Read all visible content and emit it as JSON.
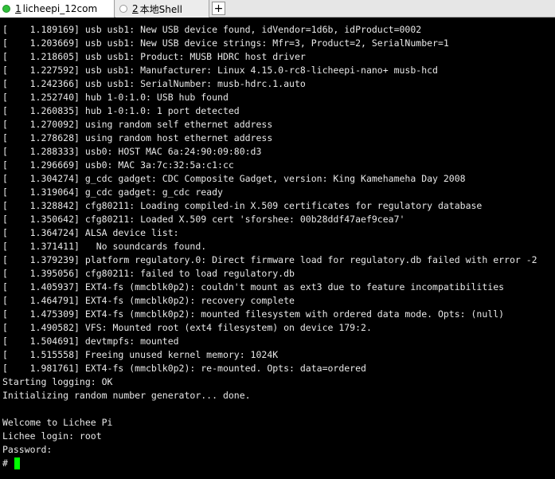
{
  "tabs": [
    {
      "number": "1",
      "label": "licheepi_12com",
      "active": true
    },
    {
      "number": "2",
      "label": "本地Shell",
      "active": false
    }
  ],
  "new_tab_label": "+",
  "terminal": {
    "lines": [
      "[    1.189169] usb usb1: New USB device found, idVendor=1d6b, idProduct=0002",
      "[    1.203669] usb usb1: New USB device strings: Mfr=3, Product=2, SerialNumber=1",
      "[    1.218605] usb usb1: Product: MUSB HDRC host driver",
      "[    1.227592] usb usb1: Manufacturer: Linux 4.15.0-rc8-licheepi-nano+ musb-hcd",
      "[    1.242366] usb usb1: SerialNumber: musb-hdrc.1.auto",
      "[    1.252740] hub 1-0:1.0: USB hub found",
      "[    1.260835] hub 1-0:1.0: 1 port detected",
      "[    1.270092] using random self ethernet address",
      "[    1.278628] using random host ethernet address",
      "[    1.288333] usb0: HOST MAC 6a:24:90:09:80:d3",
      "[    1.296669] usb0: MAC 3a:7c:32:5a:c1:cc",
      "[    1.304274] g_cdc gadget: CDC Composite Gadget, version: King Kamehameha Day 2008",
      "[    1.319064] g_cdc gadget: g_cdc ready",
      "[    1.328842] cfg80211: Loading compiled-in X.509 certificates for regulatory database",
      "[    1.350642] cfg80211: Loaded X.509 cert 'sforshee: 00b28ddf47aef9cea7'",
      "[    1.364724] ALSA device list:",
      "[    1.371411]   No soundcards found.",
      "[    1.379239] platform regulatory.0: Direct firmware load for regulatory.db failed with error -2",
      "[    1.395056] cfg80211: failed to load regulatory.db",
      "[    1.405937] EXT4-fs (mmcblk0p2): couldn't mount as ext3 due to feature incompatibilities",
      "[    1.464791] EXT4-fs (mmcblk0p2): recovery complete",
      "[    1.475309] EXT4-fs (mmcblk0p2): mounted filesystem with ordered data mode. Opts: (null)",
      "[    1.490582] VFS: Mounted root (ext4 filesystem) on device 179:2.",
      "[    1.504691] devtmpfs: mounted",
      "[    1.515558] Freeing unused kernel memory: 1024K",
      "[    1.981761] EXT4-fs (mmcblk0p2): re-mounted. Opts: data=ordered",
      "Starting logging: OK",
      "Initializing random number generator... done.",
      "",
      "Welcome to Lichee Pi",
      "Lichee login: root",
      "Password:"
    ],
    "prompt": "# ",
    "cursor_color": "#00ff00"
  },
  "colors": {
    "terminal_background": "#000000",
    "terminal_text": "#e8e8e8",
    "active_tab_indicator": "#2fbf3a"
  },
  "icons": {
    "active_tab": "status-dot-connected-icon",
    "inactive_tab": "status-dot-idle-icon",
    "new_tab": "plus-icon"
  }
}
